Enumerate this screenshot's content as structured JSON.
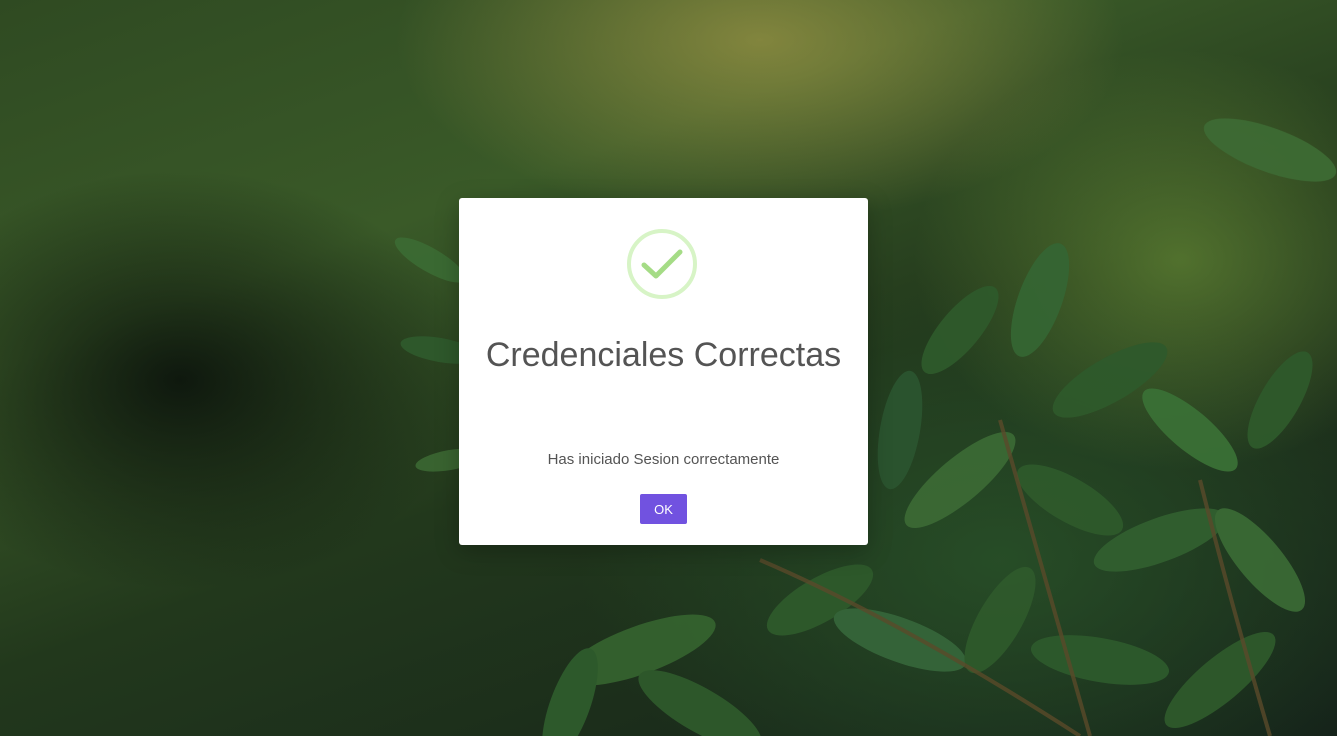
{
  "dialog": {
    "title": "Credenciales Correctas",
    "message": "Has iniciado Sesion correctamente",
    "confirm_label": "OK",
    "icon": "success-check-icon"
  },
  "colors": {
    "confirm_button": "#7152e0",
    "success_ring": "#d7f4c6",
    "success_check": "#a5dc86",
    "text": "#545454"
  }
}
